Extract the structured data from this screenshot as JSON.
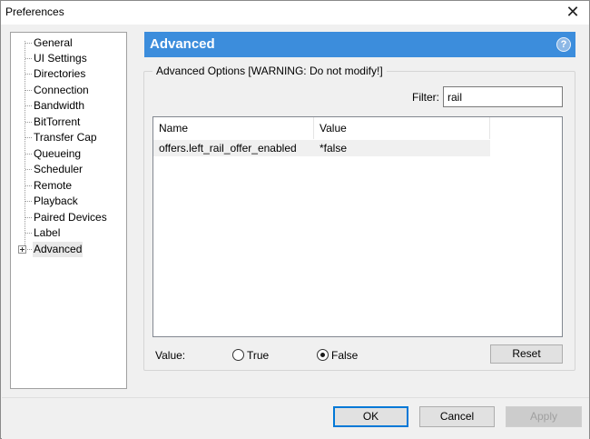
{
  "window": {
    "title": "Preferences",
    "close_glyph": "✕"
  },
  "tree": {
    "items": [
      {
        "label": "General"
      },
      {
        "label": "UI Settings"
      },
      {
        "label": "Directories"
      },
      {
        "label": "Connection"
      },
      {
        "label": "Bandwidth"
      },
      {
        "label": "BitTorrent"
      },
      {
        "label": "Transfer Cap"
      },
      {
        "label": "Queueing"
      },
      {
        "label": "Scheduler"
      },
      {
        "label": "Remote"
      },
      {
        "label": "Playback"
      },
      {
        "label": "Paired Devices"
      },
      {
        "label": "Label"
      },
      {
        "label": "Advanced",
        "selected": true,
        "expandable": true
      }
    ]
  },
  "header": {
    "title": "Advanced",
    "help_glyph": "?"
  },
  "group": {
    "legend": "Advanced Options [WARNING: Do not modify!]",
    "filter_label": "Filter:",
    "filter_value": "rail"
  },
  "list": {
    "columns": [
      "Name",
      "Value"
    ],
    "rows": [
      {
        "name": "offers.left_rail_offer_enabled",
        "value": "*false"
      }
    ]
  },
  "value_row": {
    "label": "Value:",
    "true_label": "True",
    "false_label": "False",
    "selected": "false",
    "reset_label": "Reset"
  },
  "footer": {
    "ok_label": "OK",
    "cancel_label": "Cancel",
    "apply_label": "Apply"
  },
  "colors": {
    "header_bg": "#3c8ddc",
    "ok_border": "#0078d7"
  }
}
